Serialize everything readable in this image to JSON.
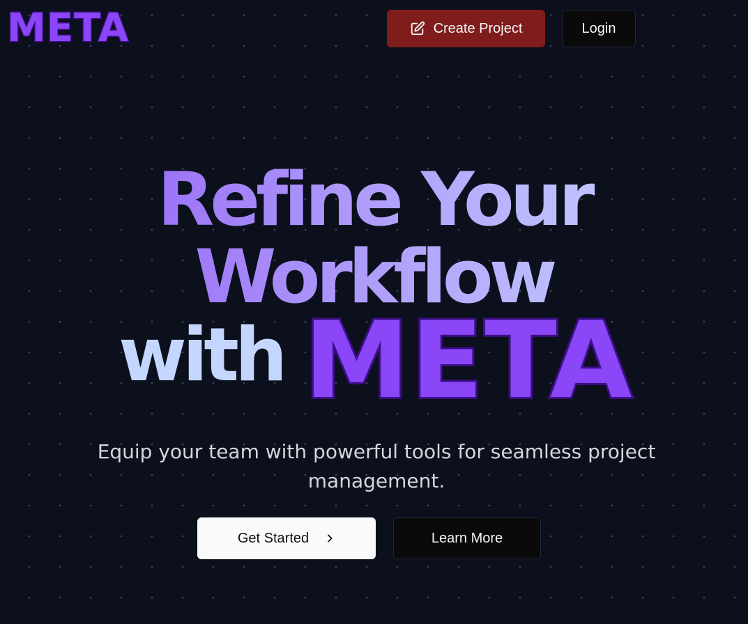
{
  "header": {
    "logo": "META",
    "create_project_label": "Create Project",
    "create_project_icon": "edit-icon",
    "login_label": "Login"
  },
  "hero": {
    "title_line1": "Refine Your",
    "title_line2": "Workflow",
    "title_line3_prefix": "with",
    "title_line3_brand": "META",
    "subtitle": "Equip your team with powerful tools for seamless project management.",
    "get_started_label": "Get Started",
    "get_started_icon": "chevron-right-icon",
    "learn_more_label": "Learn More"
  },
  "colors": {
    "background": "#0b101c",
    "brand_purple": "#8b46f8",
    "brand_outline": "#3b0f86",
    "create_button": "#7f1d1d",
    "gradient_start": "#8e55f5",
    "gradient_end": "#c8dcff"
  }
}
